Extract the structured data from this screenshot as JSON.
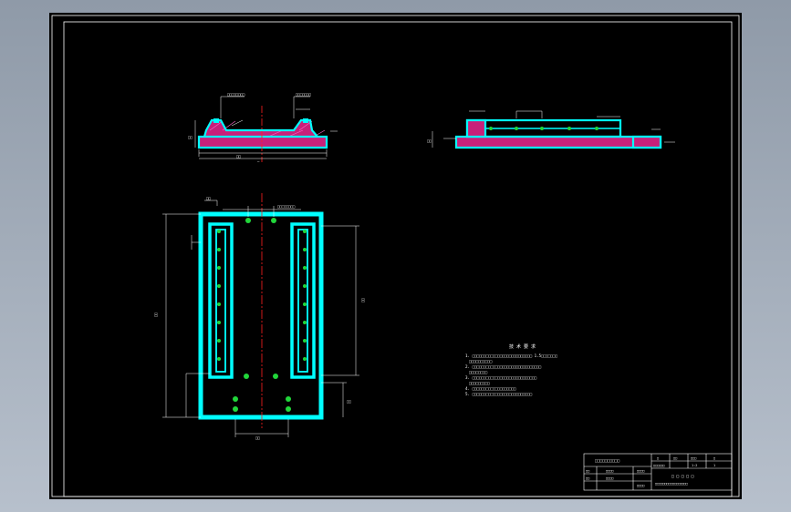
{
  "colors": {
    "background": "#000000",
    "frame": "#ffffff",
    "part_fill": "#00ffff",
    "section_hatch": "#c8207a",
    "center_line": "#ff2020",
    "holes": "#21d63a",
    "dimensions": "#ffffff"
  },
  "top_section_view": {
    "callout_left": "□□□□□□□□",
    "callout_right": "□□□□□□□",
    "dim_bottom": "□□",
    "dim_side": "□□"
  },
  "side_section_view": {
    "dim_side": "□□"
  },
  "plan_view": {
    "dim_top_left": "□□",
    "dim_top_right": "□□□□□□□□",
    "dim_left": "□□",
    "dim_right": "□□",
    "dim_right_lower": "□□",
    "dim_bottom": "□□"
  },
  "notes": {
    "heading": "技 术 要 求",
    "lines": [
      "1. □□□□□□□□□□□□□□□□□□□□□□□□□□ 1.5□□□□□□□",
      "□□□□□□□□□□",
      "2. □□□□□□□□□□□□□□□□□□□□□□□□□□□□□□",
      "□□□□□□□□",
      "3. □□□□□□□□□□□□□□□□□□□□□□□□□□□□",
      "□□□□□□□□□",
      "4. □□□□□□□□□□□□□□□□□□□",
      "5. □□□□□□□□□□□□□□□□□□□□□□□□□□"
    ]
  },
  "title_block": {
    "labels_left": [
      "□□□□□□□□□□"
    ],
    "row_a": [
      "□□",
      "□□□□",
      "□□□□"
    ],
    "row_b": [
      "□□",
      "□□□□",
      "□□□□"
    ],
    "top_cells": [
      "□",
      "□□",
      "□□□",
      "□"
    ],
    "middle_cells": [
      "□□□□□□",
      "1:2",
      "1"
    ],
    "drawing_title": "□ □ □ □ □",
    "drawing_subtitle": "□□□□□□□□□□□□□□□□□"
  }
}
